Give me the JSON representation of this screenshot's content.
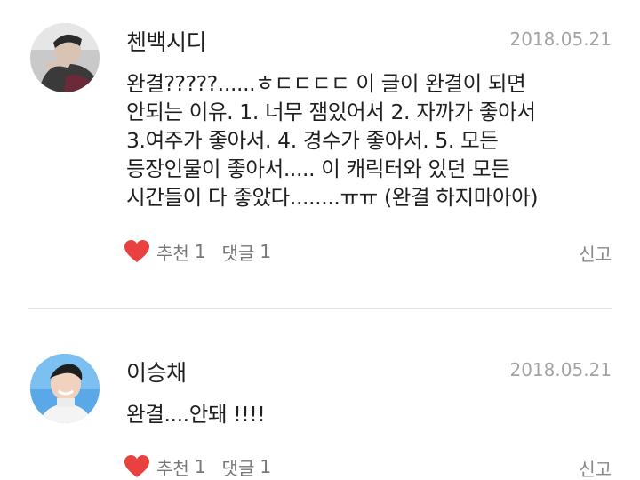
{
  "comments": [
    {
      "username": "첸백시디",
      "date": "2018.05.21",
      "text": "완결?????......ㅎㄷㄷㄷㄷ 이 글이 완결이 되면\n안되는 이유. 1. 너무 잼있어서 2. 자까가 좋아서\n3.여주가 좋아서. 4. 경수가 좋아서. 5. 모든\n등장인물이 좋아서..... 이 캐릭터와 있던 모든\n시간들이 다 좋았다........ㅠㅠ (완결 하지마아아)",
      "like_label": "추천",
      "like_count": "1",
      "reply_label": "댓글",
      "reply_count": "1",
      "report_label": "신고"
    },
    {
      "username": "이승채",
      "date": "2018.05.21",
      "text": "완결....안돼 !!!!",
      "like_label": "추천",
      "like_count": "1",
      "reply_label": "댓글",
      "reply_count": "1",
      "report_label": "신고"
    }
  ],
  "colors": {
    "heart": "#e9413f",
    "date": "#a3a3a3",
    "action_text": "#777777",
    "divider": "#e3e3e3"
  },
  "icons": {
    "like": "heart-icon"
  }
}
